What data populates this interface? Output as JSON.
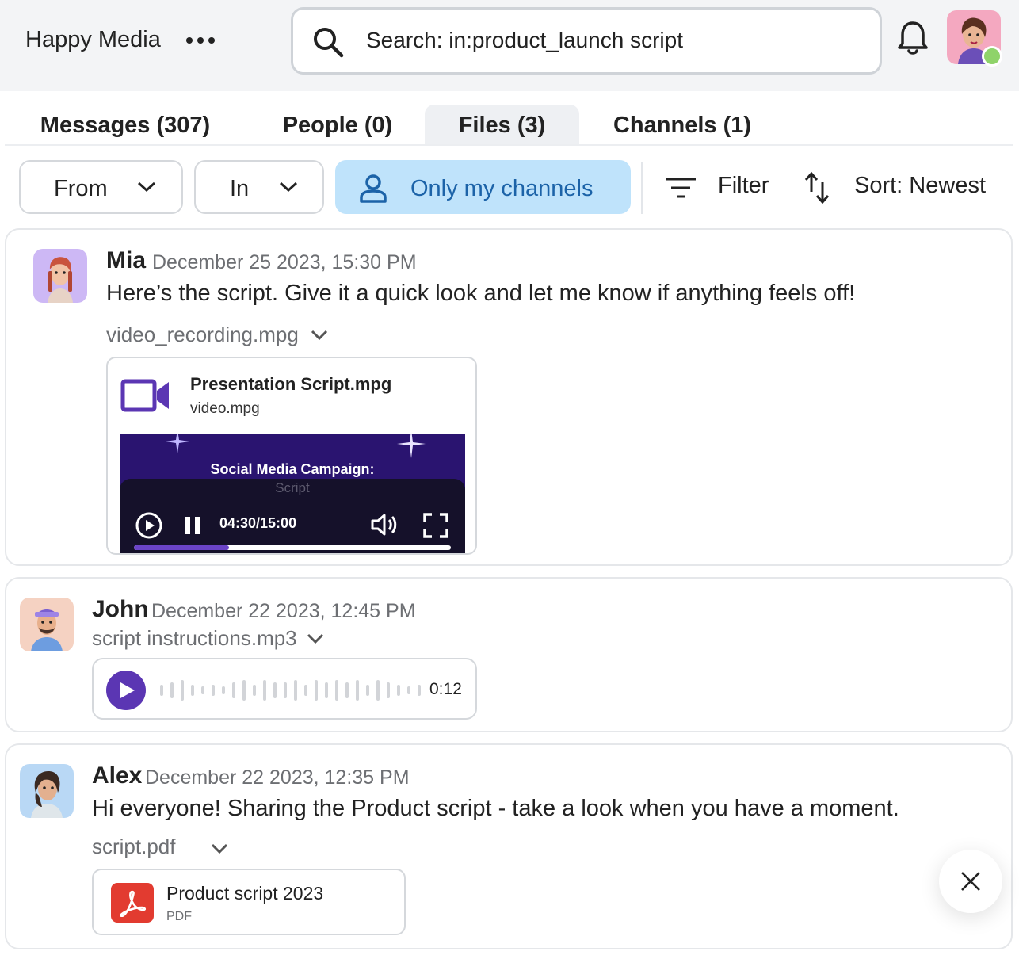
{
  "header": {
    "workspace": "Happy Media",
    "search_text": "Search: in:product_launch script"
  },
  "tabs": [
    {
      "label": "Messages (307)"
    },
    {
      "label": "People (0)"
    },
    {
      "label": "Files (3)",
      "active": true
    },
    {
      "label": "Channels (1)"
    }
  ],
  "filters": {
    "from_label": "From",
    "in_label": "In",
    "only_my_channels_label": "Only my channels",
    "filter_label": "Filter",
    "sort_label": "Sort: Newest"
  },
  "messages": [
    {
      "author": "Mia",
      "date": "December 25 2023, 15:30 PM",
      "text": "Here’s the script. Give it a quick look and let me know if anything feels off!",
      "attachment_name": "video_recording.mpg",
      "video": {
        "title": "Presentation Script.mpg",
        "subtitle": "video.mpg",
        "overlay_title": "Social Media Campaign:",
        "overlay_subtitle": "Script",
        "time": "04:30/15:00",
        "progress": 0.3
      }
    },
    {
      "author": "John",
      "date": "December 22 2023, 12:45 PM",
      "attachment_name": "script instructions.mp3",
      "audio": {
        "duration": "0:12"
      }
    },
    {
      "author": "Alex",
      "date": "December 22 2023, 12:35 PM",
      "text": "Hi everyone! Sharing the Product script - take a look when you have a moment.",
      "attachment_name": "script.pdf",
      "file": {
        "name": "Product script 2023",
        "type": "PDF"
      }
    }
  ],
  "colors": {
    "accent_purple": "#5b36b3",
    "chip_active_bg": "#bfe3fb",
    "chip_active_text": "#1c63a8",
    "presence_online": "#8fd36a",
    "pdf_red": "#e23b30"
  }
}
